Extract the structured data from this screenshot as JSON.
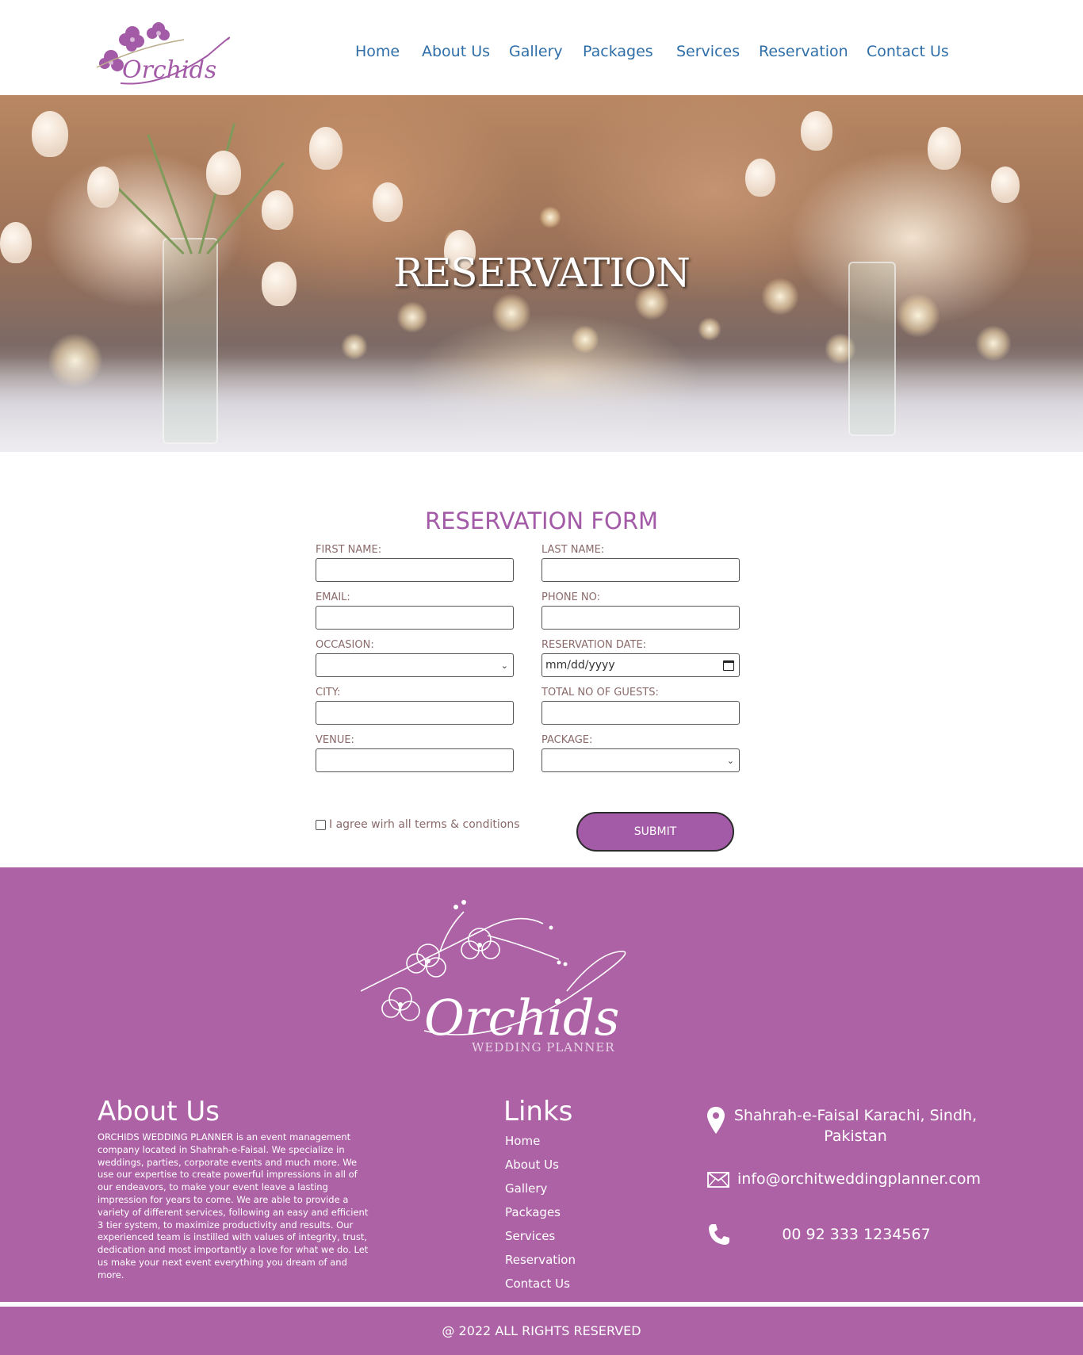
{
  "brand": {
    "logo_text": "Orchids",
    "logo_subtext": "WEDDING PLANNER",
    "accent_color": "#ad62a6",
    "nav_color": "#2f6ea8"
  },
  "nav": {
    "items": [
      "Home",
      "About Us",
      "Gallery",
      "Packages",
      "Services",
      "Reservation",
      "Contact Us"
    ]
  },
  "hero": {
    "title": "RESERVATION"
  },
  "form": {
    "title": "RESERVATION FORM",
    "first_name_label": "FIRST NAME:",
    "last_name_label": "LAST NAME:",
    "email_label": "EMAIL:",
    "phone_label": "PHONE NO:",
    "occasion_label": "OCCASION:",
    "date_label": "RESERVATION DATE:",
    "date_placeholder": "mm/dd/yyyy",
    "city_label": "CITY:",
    "guests_label": "TOTAL NO OF GUESTS:",
    "venue_label": "VENUE:",
    "package_label": "PACKAGE:",
    "agree_label": "I agree wirh all terms & conditions",
    "submit_label": "SUBMIT"
  },
  "footer": {
    "about_title": "About Us",
    "about_text": "ORCHIDS WEDDING PLANNER is an event management company located in Shahrah-e-Faisal. We specialize in weddings, parties, corporate events and much more. We use our expertise to create powerful impressions in all of our endeavors, to make your event leave a lasting impression for years to come. We are able to provide a variety of different services, following an easy and efficient 3 tier system, to maximize productivity and results. Our experienced team is instilled with values of integrity, trust, dedication and most importantly a love for what we do. Let us make your next event everything you dream of and more.",
    "links_title": "Links",
    "links": [
      "Home",
      "About Us",
      "Gallery",
      "Packages",
      "Services",
      "Reservation",
      "Contact Us"
    ],
    "address": "Shahrah-e-Faisal Karachi, Sindh, Pakistan",
    "email": "info@orchitweddingplanner.com",
    "phone": "00 92 333 1234567",
    "copyright": "@ 2022 ALL RIGHTS RESERVED"
  }
}
